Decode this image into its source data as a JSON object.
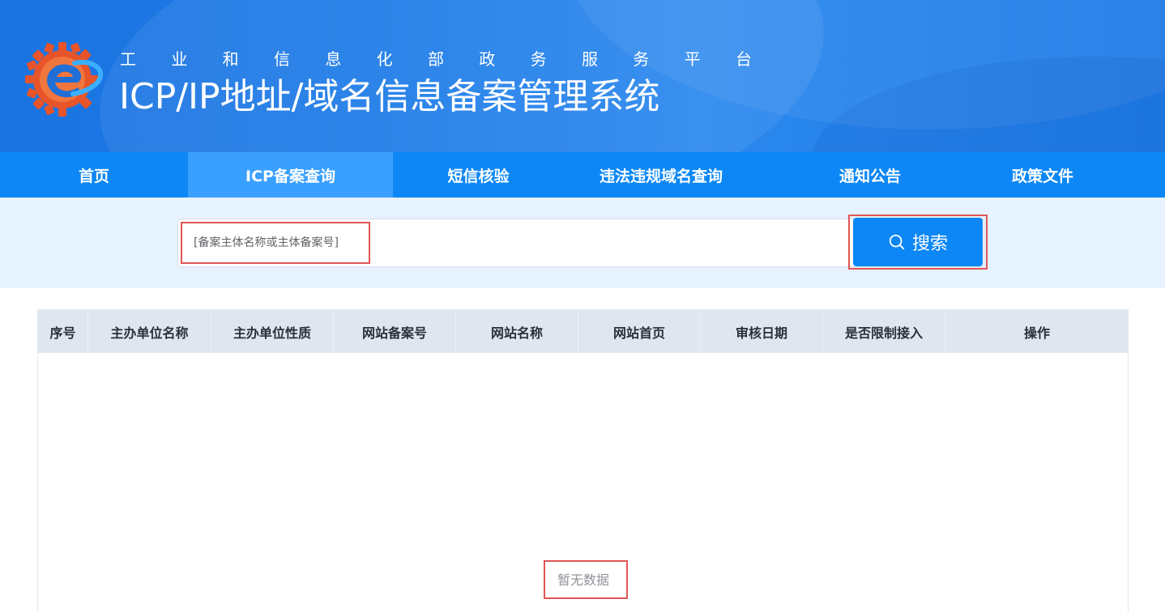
{
  "header": {
    "subtitle_chars": [
      "工",
      "业",
      "和",
      "信",
      "息",
      "化",
      "部",
      "政",
      "务",
      "服",
      "务",
      "平",
      "台"
    ],
    "title": "ICP/IP地址/域名信息备案管理系统",
    "logo_icon": "miit-gear-e-logo-icon"
  },
  "nav": {
    "items": [
      {
        "label": "首页",
        "active": false
      },
      {
        "label": "ICP备案查询",
        "active": true
      },
      {
        "label": "短信核验",
        "active": false
      },
      {
        "label": "违法违规域名查询",
        "active": false
      },
      {
        "label": "通知公告",
        "active": false
      },
      {
        "label": "政策文件",
        "active": false
      }
    ]
  },
  "search": {
    "placeholder": "[备案主体名称或主体备案号]",
    "value": "",
    "button_label": "搜索",
    "button_icon": "search-icon"
  },
  "table": {
    "columns": [
      "序号",
      "主办单位名称",
      "主办单位性质",
      "网站备案号",
      "网站名称",
      "网站首页",
      "审核日期",
      "是否限制接入",
      "操作"
    ],
    "rows": [],
    "empty_text": "暂无数据"
  },
  "colors": {
    "nav_bg": "#0c87f5",
    "nav_active": "#3aa0ff",
    "search_band": "#e6f2fd",
    "header_row": "#e0e6f0",
    "highlight": "#e05656"
  }
}
